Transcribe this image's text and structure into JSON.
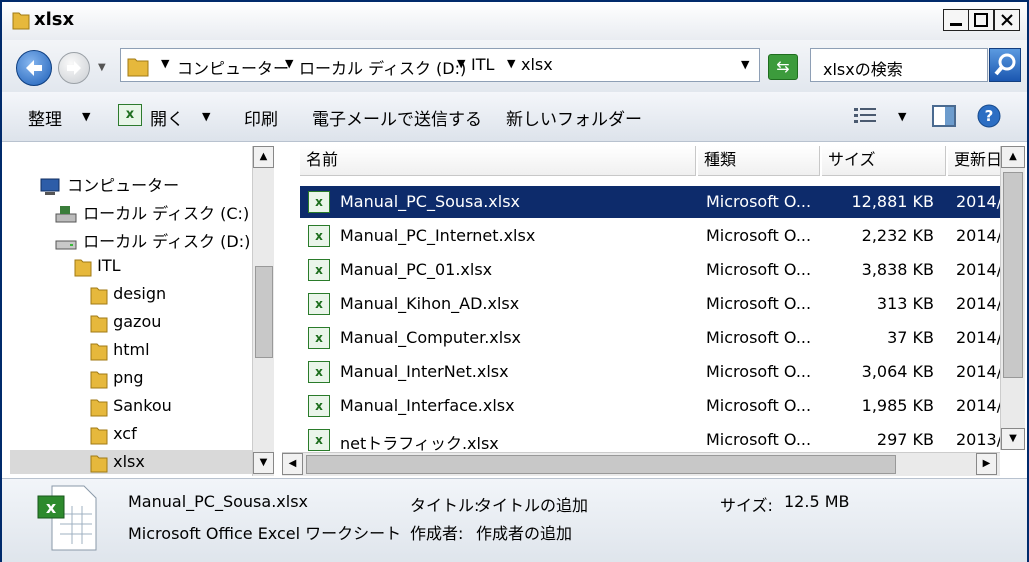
{
  "window": {
    "title": "xlsx"
  },
  "address": {
    "crumbs": [
      "コンピューター",
      "ローカル ディスク (D:)",
      "ITL",
      "xlsx"
    ]
  },
  "search": {
    "placeholder": "xlsxの検索"
  },
  "toolbar": {
    "organize": "整理",
    "open": "開く",
    "print": "印刷",
    "email": "電子メールで送信する",
    "new_folder": "新しいフォルダー"
  },
  "nav_tree": [
    {
      "label": "コンピューター",
      "icon": "computer-icon"
    },
    {
      "label": "ローカル ディスク (C:)",
      "icon": "drive-icon"
    },
    {
      "label": "ローカル ディスク (D:)",
      "icon": "drive-icon"
    },
    {
      "label": "ITL",
      "icon": "folder-icon"
    },
    {
      "label": "design",
      "icon": "folder-icon"
    },
    {
      "label": "gazou",
      "icon": "folder-icon"
    },
    {
      "label": "html",
      "icon": "folder-icon"
    },
    {
      "label": "png",
      "icon": "folder-icon"
    },
    {
      "label": "Sankou",
      "icon": "folder-icon"
    },
    {
      "label": "xcf",
      "icon": "folder-icon"
    },
    {
      "label": "xlsx",
      "icon": "folder-icon",
      "selected": true
    }
  ],
  "columns": [
    "名前",
    "種類",
    "サイズ",
    "更新日"
  ],
  "files": [
    {
      "name": "Manual_PC_Sousa.xlsx",
      "type": "Microsoft O...",
      "size": "12,881 KB",
      "date": "2014/",
      "selected": true
    },
    {
      "name": "Manual_PC_Internet.xlsx",
      "type": "Microsoft O...",
      "size": "2,232 KB",
      "date": "2014/"
    },
    {
      "name": "Manual_PC_01.xlsx",
      "type": "Microsoft O...",
      "size": "3,838 KB",
      "date": "2014/"
    },
    {
      "name": "Manual_Kihon_AD.xlsx",
      "type": "Microsoft O...",
      "size": "313 KB",
      "date": "2014/"
    },
    {
      "name": "Manual_Computer.xlsx",
      "type": "Microsoft O...",
      "size": "37 KB",
      "date": "2014/"
    },
    {
      "name": "Manual_InterNet.xlsx",
      "type": "Microsoft O...",
      "size": "3,064 KB",
      "date": "2014/"
    },
    {
      "name": "Manual_Interface.xlsx",
      "type": "Microsoft O...",
      "size": "1,985 KB",
      "date": "2014/"
    },
    {
      "name": "netトラフィック.xlsx",
      "type": "Microsoft O...",
      "size": "297 KB",
      "date": "2013/"
    }
  ],
  "details": {
    "filename": "Manual_PC_Sousa.xlsx",
    "filetype": "Microsoft Office Excel ワークシート",
    "title_label": "タイトル:",
    "title_value": "タイトルの追加",
    "author_label": "作成者:",
    "author_value": "作成者の追加",
    "size_label": "サイズ:",
    "size_value": "12.5 MB"
  },
  "colors": {
    "selection": "#0d2b6b",
    "excel_green": "#1f6e1f",
    "folder": "#e6b83c"
  }
}
